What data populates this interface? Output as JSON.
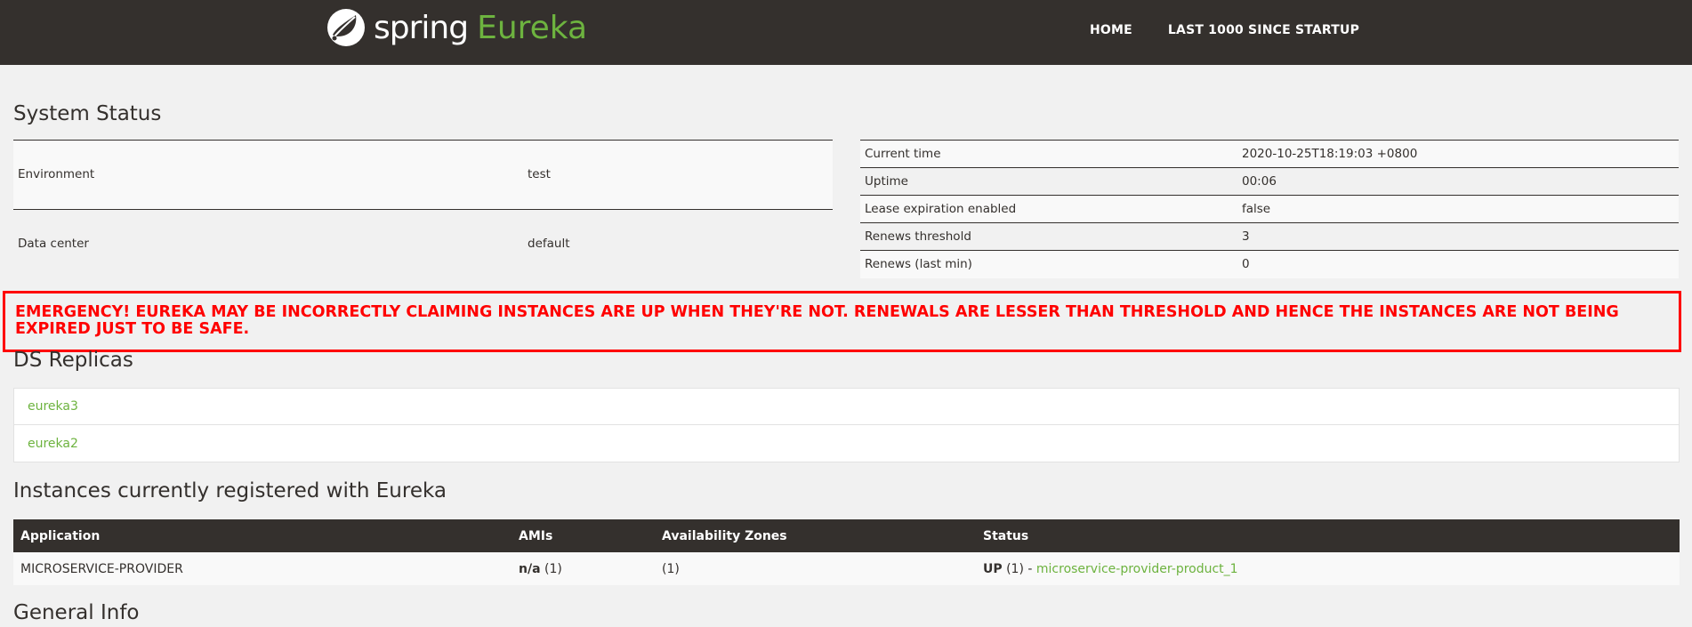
{
  "brand": {
    "spring": "spring",
    "eureka": "Eureka"
  },
  "nav": {
    "home": "HOME",
    "last1000": "LAST 1000 SINCE STARTUP"
  },
  "system_status": {
    "title": "System Status",
    "left": [
      {
        "key": "Environment",
        "value": "test"
      },
      {
        "key": "Data center",
        "value": "default"
      }
    ],
    "right": [
      {
        "key": "Current time",
        "value": "2020-10-25T18:19:03 +0800"
      },
      {
        "key": "Uptime",
        "value": "00:06"
      },
      {
        "key": "Lease expiration enabled",
        "value": "false"
      },
      {
        "key": "Renews threshold",
        "value": "3"
      },
      {
        "key": "Renews (last min)",
        "value": "0"
      }
    ]
  },
  "emergency": "EMERGENCY! EUREKA MAY BE INCORRECTLY CLAIMING INSTANCES ARE UP WHEN THEY'RE NOT. RENEWALS ARE LESSER THAN THRESHOLD AND HENCE THE INSTANCES ARE NOT BEING EXPIRED JUST TO BE SAFE.",
  "replicas": {
    "title": "DS Replicas",
    "items": [
      "eureka3",
      "eureka2"
    ]
  },
  "instances": {
    "title": "Instances currently registered with Eureka",
    "headers": [
      "Application",
      "AMIs",
      "Availability Zones",
      "Status"
    ],
    "rows": [
      {
        "application": "MICROSERVICE-PROVIDER",
        "amis_bold": "n/a",
        "amis_count": "(1)",
        "zones": "(1)",
        "status_bold": "UP",
        "status_count": "(1) - ",
        "status_link": "microservice-provider-product_1"
      }
    ]
  },
  "general_info": {
    "title": "General Info"
  },
  "colors": {
    "accent": "#6db33f",
    "nav_bg": "#34302d",
    "emergency": "#ff0000"
  }
}
